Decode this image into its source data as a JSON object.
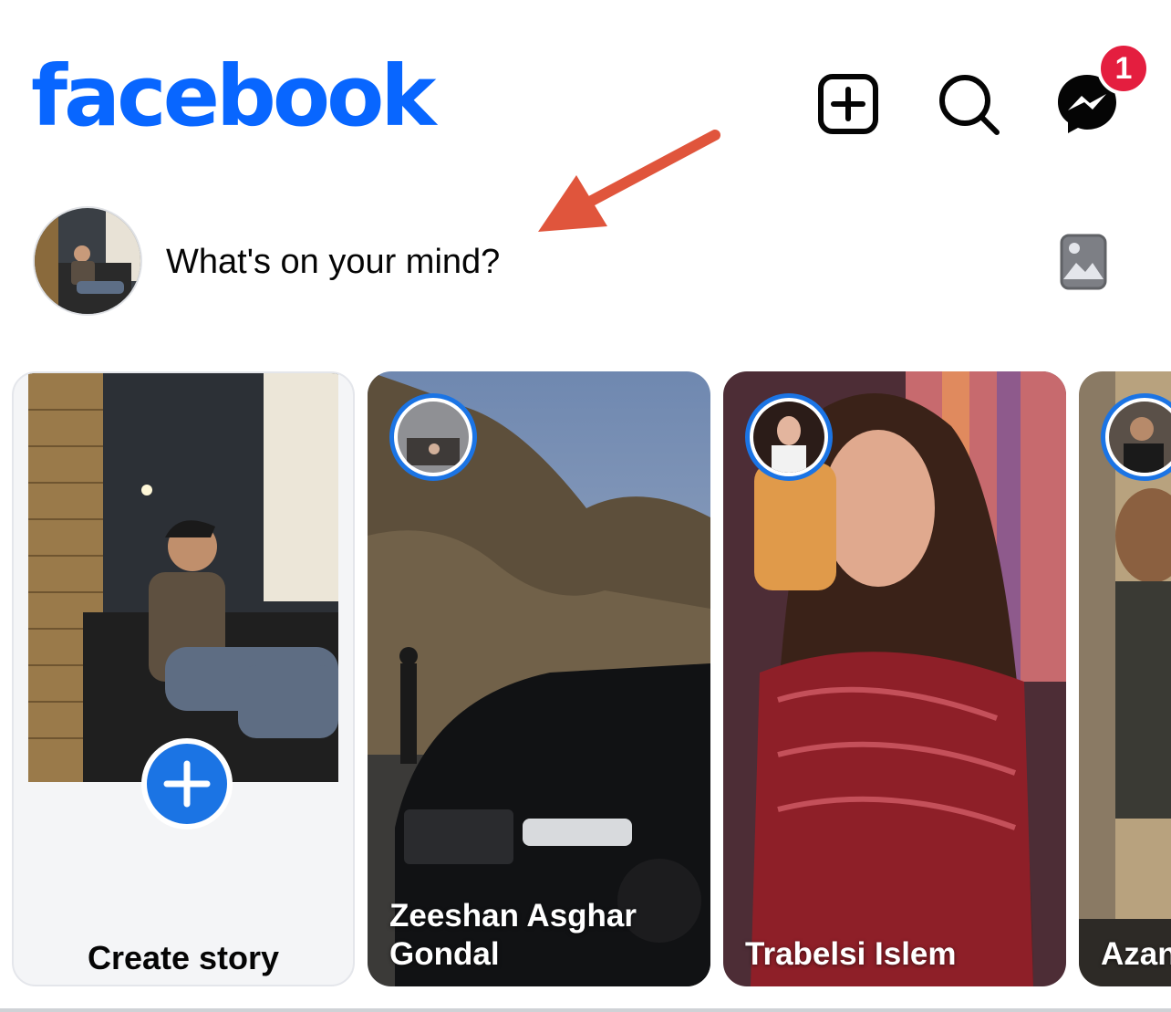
{
  "colors": {
    "brand": "#0866ff",
    "badge": "#e41e3f",
    "icon": "#050505",
    "arrow": "#e0553c",
    "story_ring": "#1b74e4"
  },
  "header": {
    "logo_text": "facebook",
    "create_icon": "plus-square-icon",
    "search_icon": "search-icon",
    "messenger_icon": "messenger-icon",
    "messenger_badge": "1"
  },
  "composer": {
    "prompt": "What's on your mind?",
    "photo_icon": "photo-icon"
  },
  "stories": {
    "create_label": "Create story",
    "items": [
      {
        "name": "Zeeshan Asghar\nGondal"
      },
      {
        "name": "Trabelsi Islem"
      },
      {
        "name": "Azan"
      }
    ]
  }
}
